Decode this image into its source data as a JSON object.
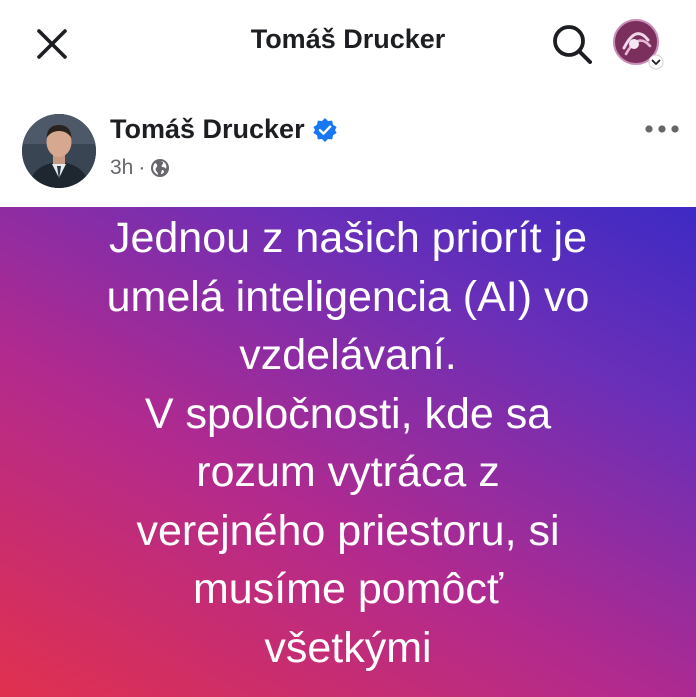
{
  "topbar": {
    "title": "Tomáš Drucker",
    "close_icon": "close-icon",
    "search_icon": "search-icon",
    "profile_icon": "profile-avatar-icon"
  },
  "post": {
    "author": "Tomáš Drucker",
    "verified": true,
    "time": "3h",
    "separator": "·",
    "audience_icon": "globe-icon",
    "more_icon": "more-horizontal-icon",
    "background_colors": [
      "#e1304e",
      "#b22a8e",
      "#6a2fb8",
      "#3d2ac4"
    ],
    "text_lines": [
      "Jednou z našich priorít je",
      "umelá inteligencia (AI) vo",
      "vzdelávaní.",
      "V spoločnosti, kde sa",
      "rozum vytráca z",
      "verejného priestoru, si",
      "musíme pomôcť",
      "všetkými"
    ]
  }
}
